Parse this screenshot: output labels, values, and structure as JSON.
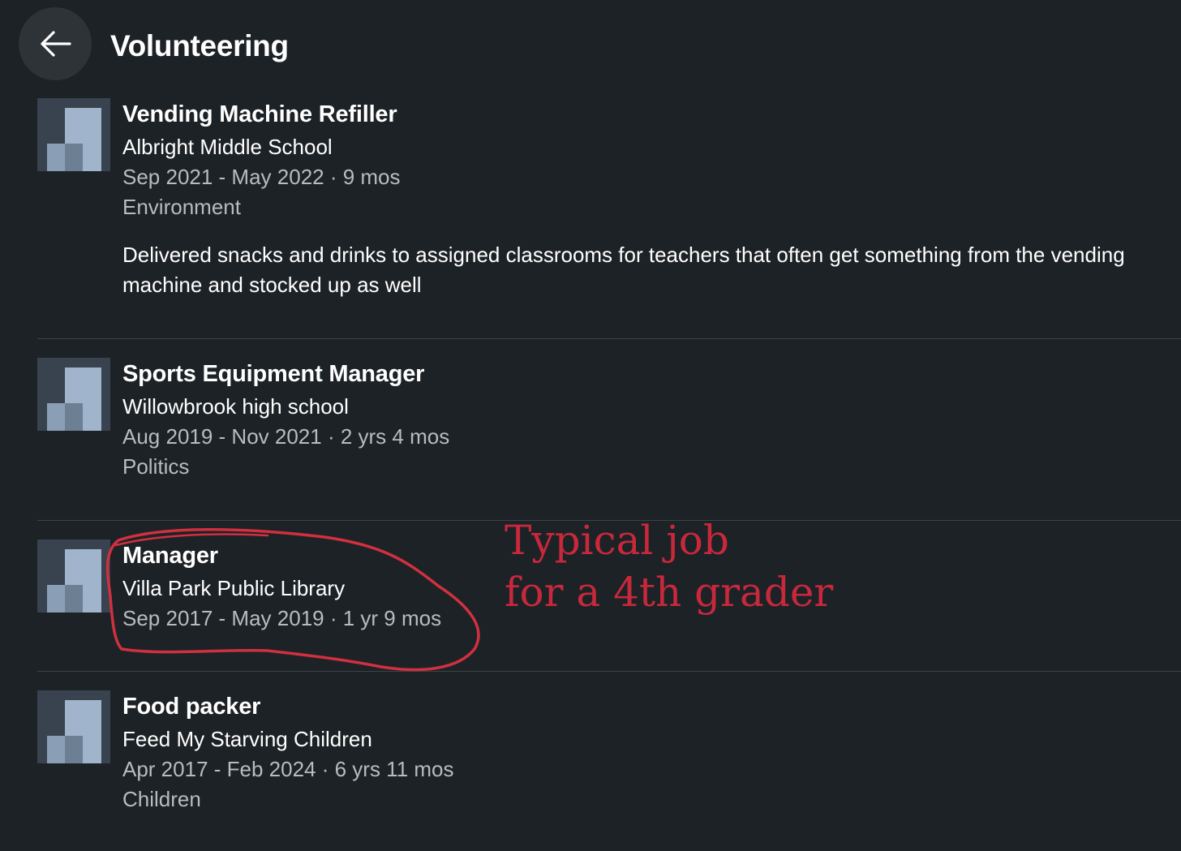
{
  "header": {
    "title": "Volunteering",
    "back_icon": "arrow-left-icon"
  },
  "entries": [
    {
      "role": "Vending Machine Refiller",
      "organization": "Albright Middle School",
      "dates": "Sep 2021 - May 2022 · 9 mos",
      "cause": "Environment",
      "description": "Delivered snacks and drinks to assigned classrooms for teachers that often get something from the vending machine and stocked up as well",
      "logo_icon": "organization-logo-placeholder-icon"
    },
    {
      "role": "Sports Equipment Manager",
      "organization": "Willowbrook high school",
      "dates": "Aug 2019 - Nov 2021 · 2 yrs 4 mos",
      "cause": "Politics",
      "logo_icon": "organization-logo-placeholder-icon"
    },
    {
      "role": "Manager",
      "organization": "Villa Park Public Library",
      "dates": "Sep 2017 - May 2019 · 1 yr 9 mos",
      "logo_icon": "organization-logo-placeholder-icon"
    },
    {
      "role": "Food packer",
      "organization": "Feed My Starving Children",
      "dates": "Apr 2017 - Feb 2024 · 6 yrs 11 mos",
      "cause": "Children",
      "logo_icon": "organization-logo-placeholder-icon"
    }
  ],
  "annotation": {
    "line1": "Typical job",
    "line2": "for a 4th grader",
    "color": "#c8283c"
  },
  "colors": {
    "background": "#1d2226",
    "secondary_text": "#b8bcbf",
    "divider": "#3c4247"
  }
}
